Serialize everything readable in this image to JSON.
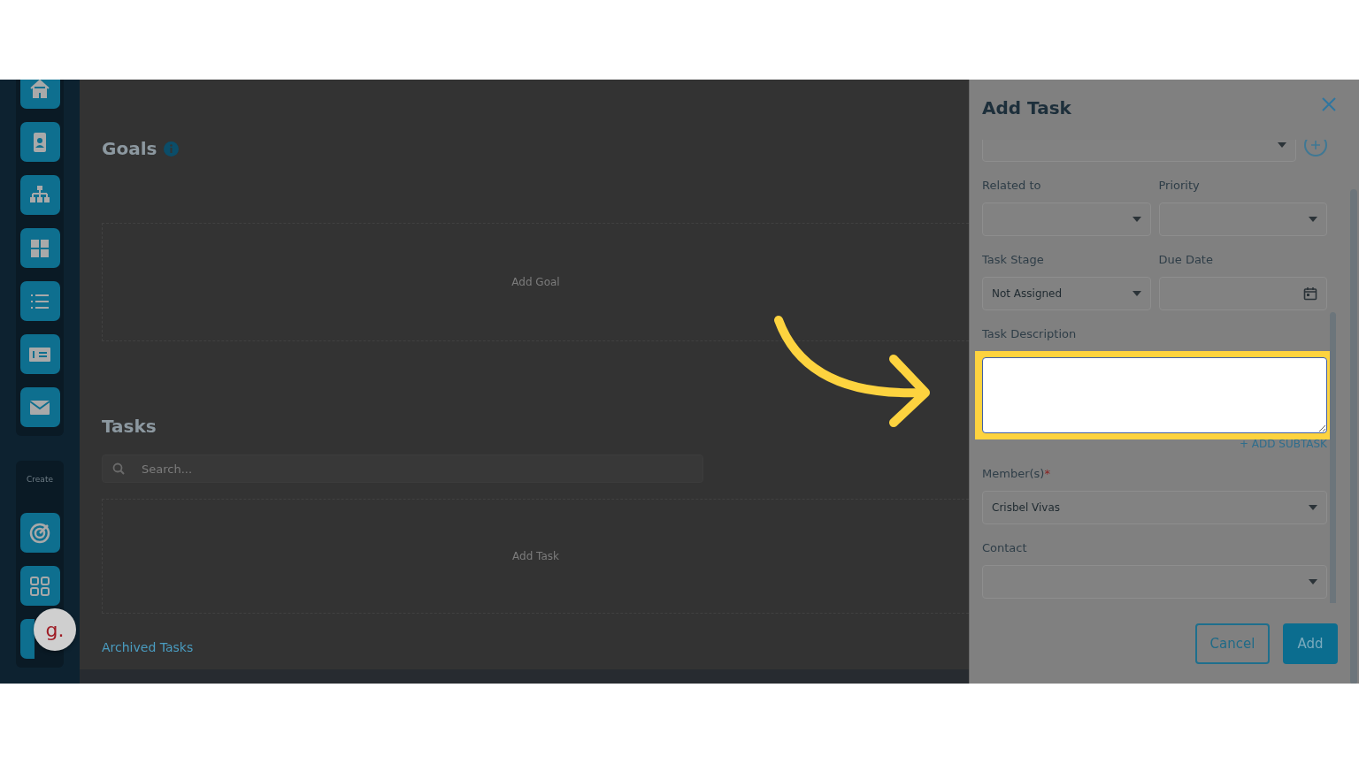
{
  "sidebar": {
    "section_label": "Create"
  },
  "assistant_badge": {
    "text": "g."
  },
  "main": {
    "goals": {
      "title": "Goals",
      "empty_text": "Add Goal"
    },
    "tasks": {
      "title": "Tasks",
      "search": {
        "placeholder": "Search..."
      },
      "empty_text": "Add Task"
    },
    "archived_link": "Archived Tasks"
  },
  "panel": {
    "title": "Add Task",
    "rows": [
      {
        "fields": [
          {
            "kind": "select",
            "add_button": true
          }
        ]
      },
      {
        "fields": [
          {
            "label": "Related to",
            "kind": "select"
          },
          {
            "label": "Priority",
            "kind": "select"
          }
        ]
      },
      {
        "fields": [
          {
            "label": "Task Stage",
            "kind": "select",
            "value": "Not Assigned"
          },
          {
            "label": "Due Date",
            "kind": "date"
          }
        ]
      },
      {
        "fields": [
          {
            "label": "Task Description",
            "kind": "textarea",
            "focused": true,
            "highlighted": true,
            "link": "+ ADD SUBTASK"
          }
        ]
      },
      {
        "fields": [
          {
            "label": "Member(s)",
            "required_mark": "*",
            "kind": "select",
            "value": "Crisbel Vivas"
          }
        ]
      },
      {
        "fields": [
          {
            "label": "Contact",
            "kind": "select"
          }
        ]
      }
    ],
    "buttons": [
      {
        "label": "Cancel",
        "kind": "outline"
      },
      {
        "label": "Add",
        "kind": "primary"
      }
    ]
  },
  "pointer_arrow": true
}
